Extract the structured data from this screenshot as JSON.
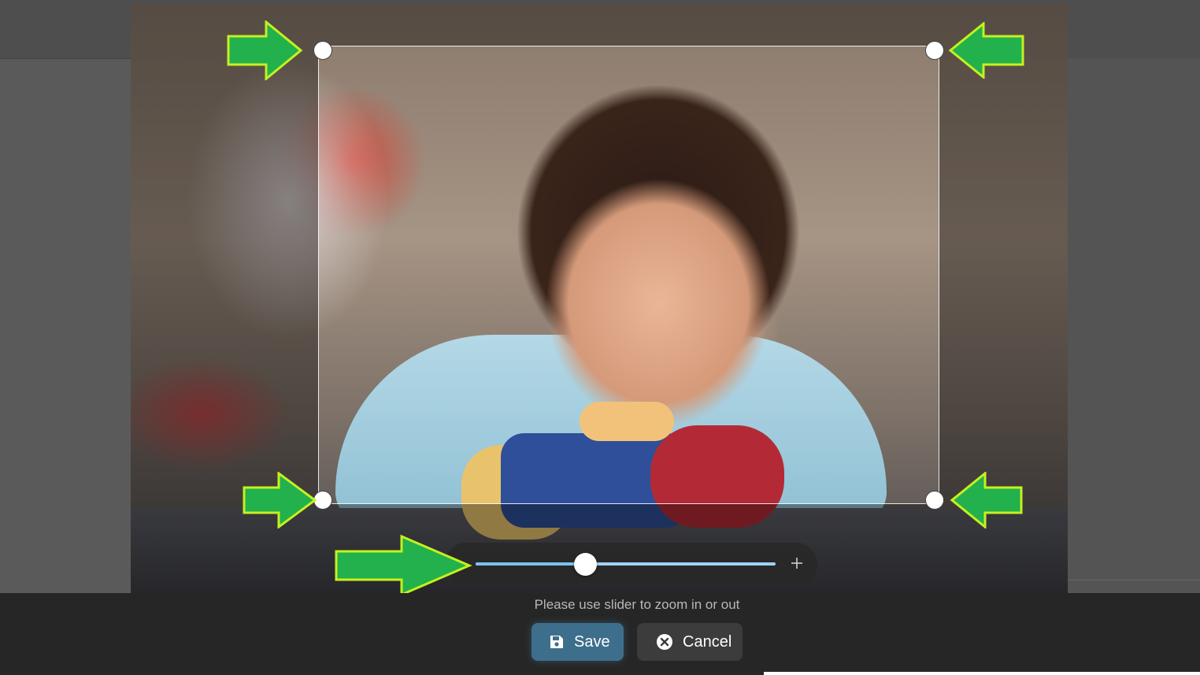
{
  "cropper": {
    "zoom": {
      "value": 0.37,
      "plus_label": "+"
    },
    "hint": "Please use slider to zoom in or out"
  },
  "actions": {
    "save_label": "Save",
    "cancel_label": "Cancel"
  },
  "colors": {
    "arrow_fill": "#22b14c",
    "arrow_outline": "#c6f01e",
    "save_button": "#3d6f8c",
    "cancel_button": "#3c3c3c",
    "slider_track": "#9fd2f5"
  },
  "icons": {
    "save": "floppy-disk-icon",
    "cancel": "circle-x-icon",
    "zoom_in": "plus-icon"
  }
}
